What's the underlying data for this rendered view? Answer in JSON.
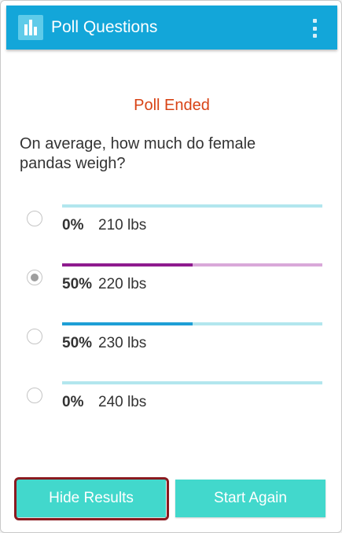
{
  "header": {
    "title": "Poll Questions",
    "app_icon": "poll-chart-icon",
    "menu_icon": "overflow-menu-icon"
  },
  "poll": {
    "status": "Poll Ended",
    "question": "On average, how much do female pandas weigh?",
    "options": [
      {
        "percent": "0%",
        "answer": "210 lbs",
        "share": 0,
        "selected": false,
        "color": "#b2e6ee",
        "fill_color": "#b2e6ee"
      },
      {
        "percent": "50%",
        "answer": "220 lbs",
        "share": 0.5,
        "selected": true,
        "color": "#d9a8d9",
        "fill_color": "#8e1b8e"
      },
      {
        "percent": "50%",
        "answer": "230 lbs",
        "share": 0.5,
        "selected": false,
        "color": "#b2e6ee",
        "fill_color": "#1e9fd6"
      },
      {
        "percent": "0%",
        "answer": "240 lbs",
        "share": 0,
        "selected": false,
        "color": "#b2e6ee",
        "fill_color": "#b2e6ee"
      }
    ]
  },
  "actions": {
    "hide_results": "Hide Results",
    "start_again": "Start Again"
  },
  "colors": {
    "app_bar": "#13a6d9",
    "status": "#d84315",
    "button": "#42d8cc",
    "highlight": "#8a1a1f"
  }
}
